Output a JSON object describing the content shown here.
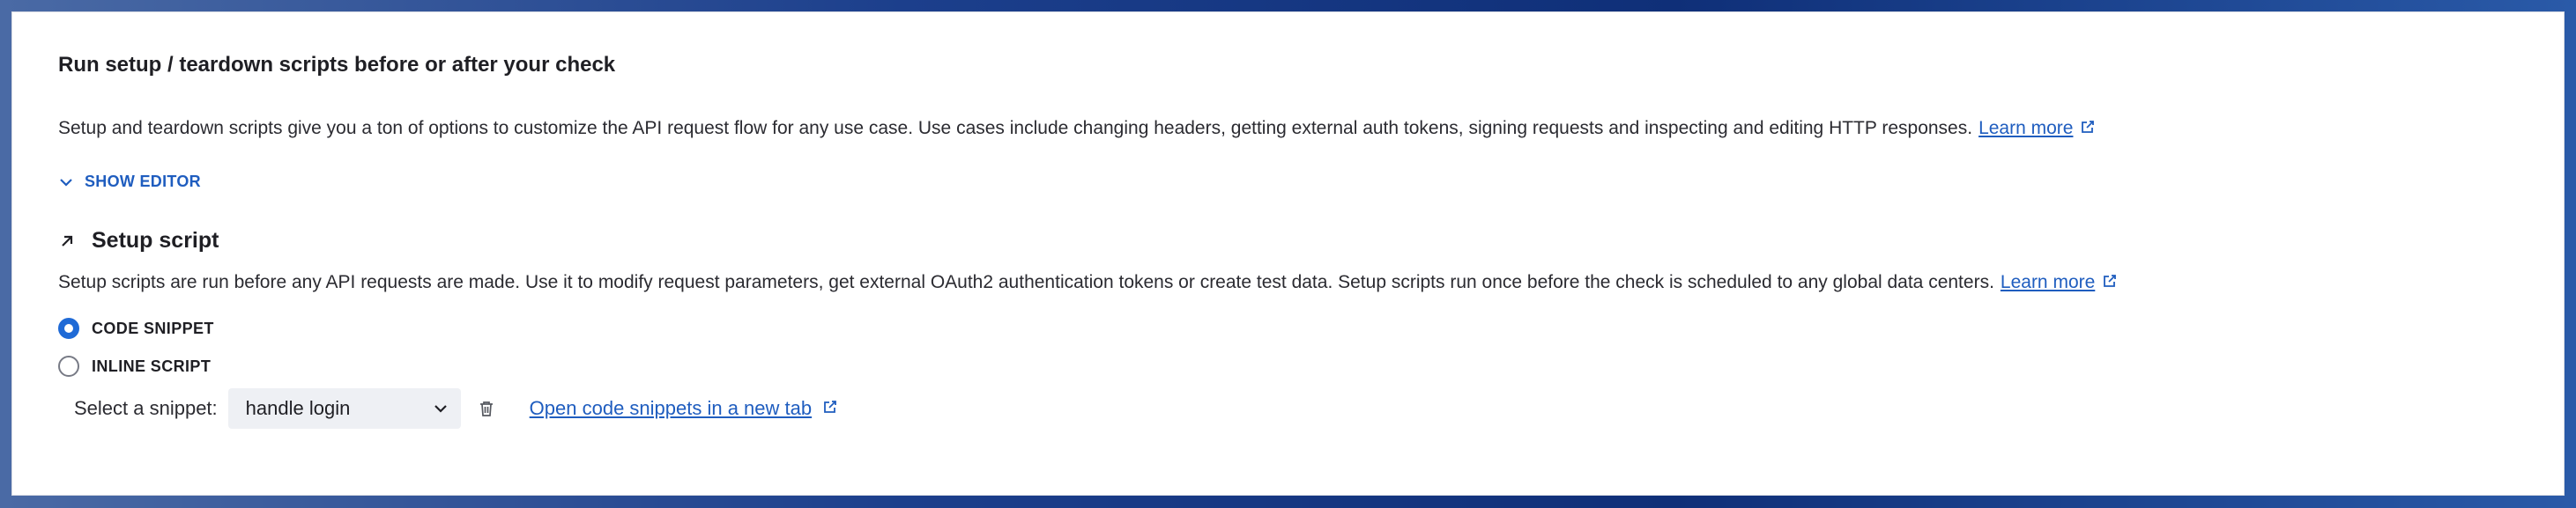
{
  "section": {
    "title": "Run setup / teardown scripts before or after your check",
    "description": "Setup and teardown scripts give you a ton of options to customize the API request flow for any use case. Use cases include changing headers, getting external auth tokens, signing requests and inspecting and editing HTTP responses.",
    "learn_more": "Learn more",
    "show_editor": "SHOW EDITOR"
  },
  "setup": {
    "heading": "Setup script",
    "description": "Setup scripts are run before any API requests are made. Use it to modify request parameters, get external OAuth2 authentication tokens or create test data. Setup scripts run once before the check is scheduled to any global data centers.",
    "learn_more": "Learn more",
    "options": [
      {
        "label": "CODE SNIPPET",
        "selected": true
      },
      {
        "label": "INLINE SCRIPT",
        "selected": false
      }
    ],
    "snippet_label": "Select a snippet:",
    "snippet_value": "handle login",
    "open_snippets_link": "Open code snippets in a new tab"
  },
  "colors": {
    "accent": "#1f6ad6",
    "link": "#1f5dbf",
    "select_bg": "#eef0f4"
  }
}
